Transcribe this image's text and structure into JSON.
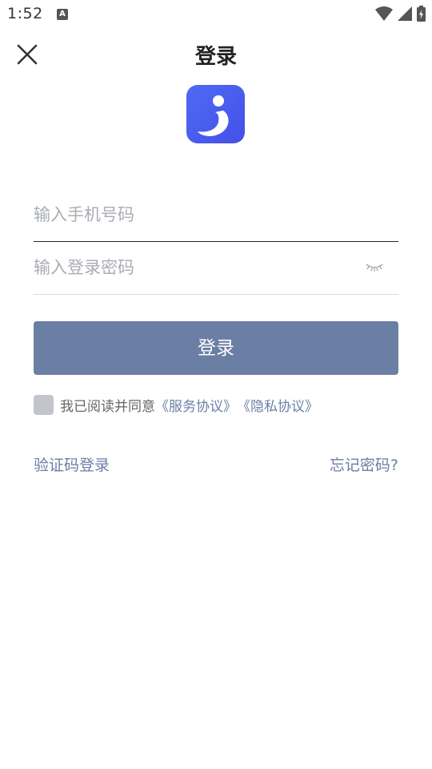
{
  "status_bar": {
    "time": "1:52",
    "notification_glyph": "A",
    "icons": [
      "wifi-icon",
      "cellular-signal-icon",
      "battery-charging-icon"
    ]
  },
  "header": {
    "title": "登录",
    "close_icon": "close-icon"
  },
  "logo": {
    "icon": "app-logo-icon",
    "colors": {
      "background": "#4a5bee",
      "mark": "#ffffff"
    }
  },
  "form": {
    "phone": {
      "placeholder": "输入手机号码",
      "value": ""
    },
    "password": {
      "placeholder": "输入登录密码",
      "value": "",
      "toggle_icon": "eye-closed-icon"
    },
    "submit_label": "登录"
  },
  "agreement": {
    "checked": false,
    "text": "我已阅读并同意",
    "service_link": "《服务协议》",
    "privacy_link": "《隐私协议》"
  },
  "links": {
    "sms_login": "验证码登录",
    "forgot_password": "忘记密码?"
  },
  "colors": {
    "accent": "#6b7ea4",
    "checkbox_unchecked": "#c2c5cc",
    "placeholder": "#a9adb3"
  }
}
